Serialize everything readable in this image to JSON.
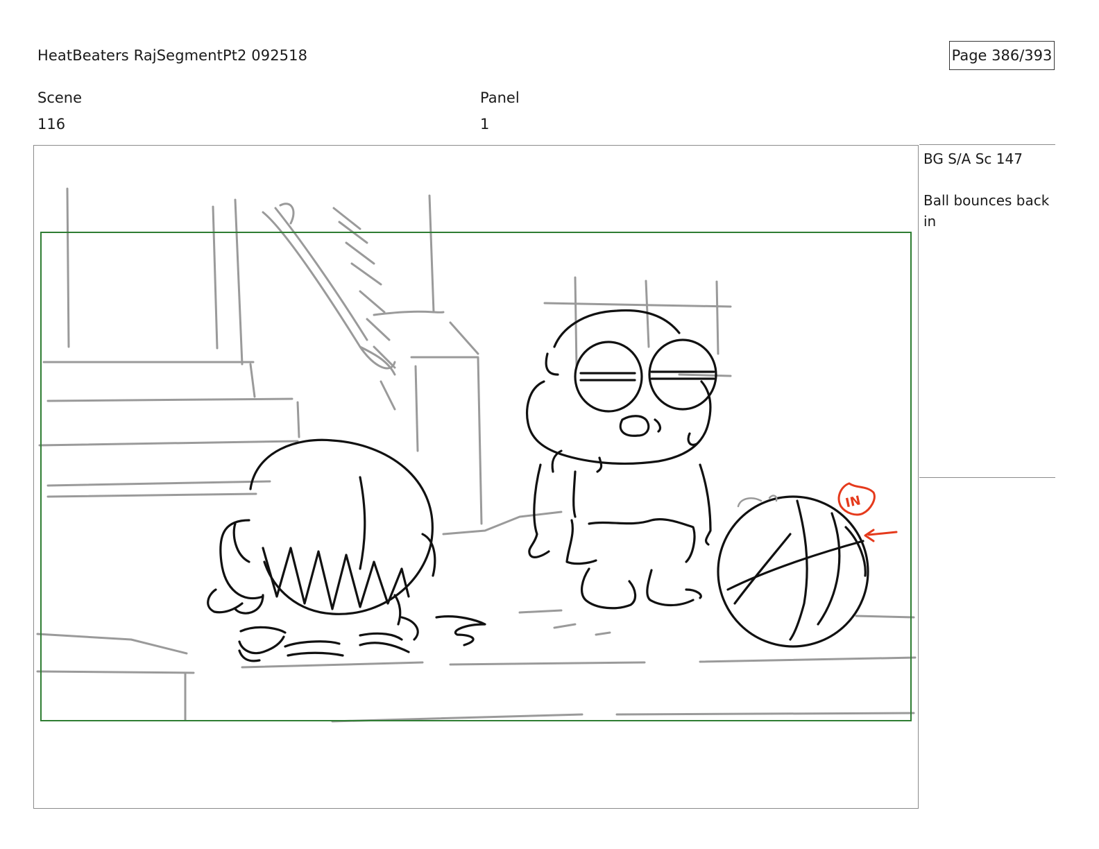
{
  "header": {
    "title": "HeatBeaters RajSegmentPt2 092518",
    "page_label": "Page 386/393"
  },
  "scene": {
    "label": "Scene",
    "value": "116"
  },
  "panel": {
    "label": "Panel",
    "value": "1"
  },
  "notes": {
    "action": "BG S/A Sc 147",
    "description": "Ball bounces back in"
  },
  "drawing": {
    "annotation_text": "IN",
    "colors": {
      "safe_frame": "#2e7d32",
      "annotation": "#e53a1c",
      "line_art": "#111111",
      "background_sketch": "#9a9a9a"
    }
  }
}
